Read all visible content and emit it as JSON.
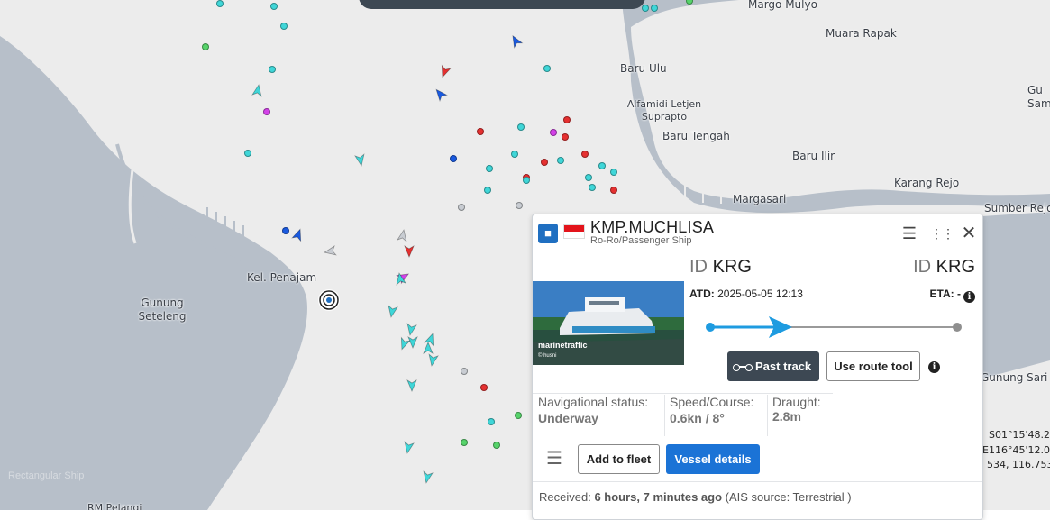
{
  "map": {
    "places": [
      {
        "name": "Margo Mulyo"
      },
      {
        "name": "Muara Rapak"
      },
      {
        "name": "Baru Ulu"
      },
      {
        "name": "Alfamidi Letjen\nSuprapto"
      },
      {
        "name": "Baru Tengah"
      },
      {
        "name": "Baru Ilir"
      },
      {
        "name": "Karang Rejo"
      },
      {
        "name": "Margasari"
      },
      {
        "name": "Sumber Rejo"
      },
      {
        "name": "Kel. Penajam"
      },
      {
        "name": "Gunung\nSeteleng"
      },
      {
        "name": "Gunung Sari U"
      },
      {
        "name": "Gu\nSam"
      },
      {
        "name": "RM Pelangi"
      }
    ],
    "coords": {
      "line1": "S01°15'48.28",
      "line2": "E116°45'12.02",
      "line3": "534, 116.7533)"
    },
    "faint_label": "Rectangular Ship",
    "colors": {
      "cyan": "#3fd6d8",
      "red": "#e53030",
      "green": "#56d36a",
      "blue": "#1a5ae0",
      "magenta": "#d341e8",
      "gray": "#c8ccd2"
    }
  },
  "popup": {
    "vessel_name": "KMP.MUCHLISA",
    "vessel_type": "Ro-Ro/Passenger Ship",
    "type_icon": "passenger-ship-icon",
    "flag": "Indonesia",
    "departure_id_prefix": "ID",
    "departure_port": "KRG",
    "arrival_id_prefix": "ID",
    "arrival_port": "KRG",
    "atd_label": "ATD:",
    "atd_value": "2025-05-05 12:13",
    "eta_label": "ETA:",
    "eta_value": "-",
    "progress": 0.3,
    "past_track_label": "Past track",
    "route_tool_label": "Use route tool",
    "nav_status_label": "Navigational status:",
    "nav_status_value": "Underway",
    "speed_label": "Speed/Course:",
    "speed_value": "0.6kn / 8°",
    "draught_label": "Draught:",
    "draught_value": "2.8m",
    "add_fleet_label": "Add to fleet",
    "vessel_details_label": "Vessel details",
    "received_label": "Received:",
    "received_value": "6 hours, 7 minutes ago",
    "ais_source": "(AIS source: Terrestrial )",
    "photo_watermark": "marinetraffic",
    "photo_credit": "© husni"
  }
}
